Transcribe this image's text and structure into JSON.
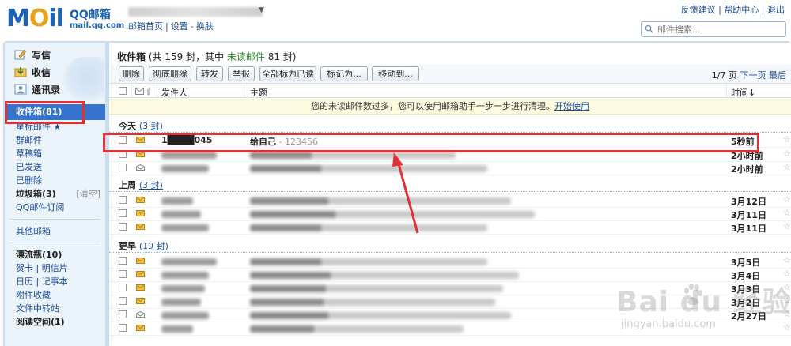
{
  "header": {
    "logo_mail": "MOil",
    "logo_qq": "QQ邮箱",
    "logo_url": "mail.qq.com",
    "links": [
      "邮箱首页",
      "|",
      "设置",
      "-",
      "换肤"
    ],
    "right_links": "反馈建议 | 帮助中心 | 退出",
    "search_placeholder": "邮件搜索..."
  },
  "sidebar": {
    "actions": [
      {
        "label": "写信",
        "icon": "pencil-icon"
      },
      {
        "label": "收信",
        "icon": "inbox-icon"
      },
      {
        "label": "通讯录",
        "icon": "contacts-icon"
      }
    ],
    "folders": [
      {
        "label": "收件箱(81)",
        "active": true
      },
      {
        "label": "星标邮件 ★"
      },
      {
        "label": "群邮件"
      },
      {
        "label": "草稿箱"
      },
      {
        "label": "已发送"
      },
      {
        "label": "已删除"
      },
      {
        "label": "垃圾箱(3)",
        "extra": "[清空]",
        "bold": true
      },
      {
        "label": "QQ邮件订阅"
      }
    ],
    "other": [
      {
        "label": "其他邮箱"
      }
    ],
    "apps": [
      {
        "label": "漂流瓶(10)",
        "bold": true
      },
      {
        "label": "贺卡 | 明信片"
      },
      {
        "label": "日历 | 记事本"
      },
      {
        "label": "附件收藏"
      },
      {
        "label": "文件中转站"
      },
      {
        "label": "阅读空间(1)",
        "bold": true
      }
    ]
  },
  "content": {
    "title_prefix": "收件箱",
    "title_mid": " (共 159 封，其中 ",
    "title_unread": "未读邮件",
    "title_suffix": " 81 封)",
    "toolbar": {
      "delete": "删除",
      "delete_forever": "彻底删除",
      "forward": "转发",
      "report": "举报",
      "mark_all_read": "全部标为已读",
      "mark_as": "标记为...",
      "move_to": "移动到..."
    },
    "pager": {
      "page": "1/7",
      "page_word": "页",
      "next": "下一页",
      "last": "最后"
    },
    "columns": {
      "sender": "发件人",
      "subject": "主题",
      "time": "时间↓"
    },
    "notice": "您的未读邮件数过多，您可以使用邮箱助手一步一步进行清理。",
    "notice_link": "开始使用",
    "groups": [
      {
        "label": "今天",
        "count": "(3 封)"
      },
      {
        "label": "上周",
        "count": "(3 封)"
      },
      {
        "label": "更早",
        "count": "(19 封)"
      }
    ],
    "rows": [
      {
        "sender": "1████045",
        "subject": "给自己",
        "preview": " - 123456",
        "time": "5秒前"
      },
      {
        "sender": "",
        "subject": "",
        "preview": "",
        "time": "2小时前"
      },
      {
        "sender": "",
        "subject": "",
        "preview": "",
        "time": "2小时前"
      },
      {
        "sender": "",
        "subject": "",
        "preview": "",
        "time": "3月12日"
      },
      {
        "sender": "",
        "subject": "",
        "preview": "",
        "time": "3月11日"
      },
      {
        "sender": "",
        "subject": "",
        "preview": "",
        "time": "3月11日"
      },
      {
        "sender": "",
        "subject": "",
        "preview": "",
        "time": "3月5日"
      },
      {
        "sender": "",
        "subject": "",
        "preview": "",
        "time": "3月4日"
      },
      {
        "sender": "",
        "subject": "",
        "preview": "",
        "time": "3月3日"
      },
      {
        "sender": "",
        "subject": "",
        "preview": "",
        "time": "3月2日"
      },
      {
        "sender": "",
        "subject": "",
        "preview": "",
        "time": "2月27日"
      },
      {
        "sender": "",
        "subject": "",
        "preview": "",
        "time": ""
      }
    ]
  },
  "watermark": {
    "text": "Bai du 经验",
    "url": "jingyan.baidu.com"
  },
  "colors": {
    "accent": "#3673cd",
    "highlight": "#e03138",
    "frame": "#c9dcf0"
  }
}
